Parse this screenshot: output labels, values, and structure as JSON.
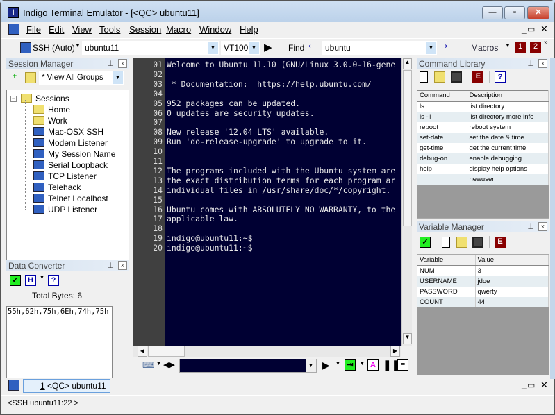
{
  "window": {
    "title": "Indigo Terminal Emulator - [<QC> ubuntu11]",
    "minimize": "—",
    "maximize": "▫",
    "close": "✕"
  },
  "menu": [
    "File",
    "Edit",
    "View",
    "Tools",
    "Session",
    "Macro",
    "Window",
    "Help"
  ],
  "toolbar": {
    "protocol": "SSH (Auto)",
    "host": "ubuntu11",
    "emulation": "VT100",
    "find_label": "Find",
    "find_value": "ubuntu",
    "macros_label": "Macros",
    "macro1": "1",
    "macro2": "2"
  },
  "session_manager": {
    "title": "Session  Manager",
    "group_filter": "* View All Groups",
    "root": "Sessions",
    "items": [
      {
        "label": "Home",
        "icon": "folder"
      },
      {
        "label": "Work",
        "icon": "folder"
      },
      {
        "label": "Mac-OSX SSH",
        "icon": "ssh"
      },
      {
        "label": "Modem Listener",
        "icon": "modem"
      },
      {
        "label": "My Session Name",
        "icon": "ssh"
      },
      {
        "label": "Serial Loopback",
        "icon": "serial"
      },
      {
        "label": "TCP Listener",
        "icon": "ssh"
      },
      {
        "label": "Telehack",
        "icon": "telnet"
      },
      {
        "label": "Telnet Localhost",
        "icon": "telnet"
      },
      {
        "label": "UDP Listener",
        "icon": "ssh"
      }
    ]
  },
  "data_converter": {
    "title": "Data Converter",
    "total_bytes": "Total Bytes: 6",
    "output": "55h,62h,75h,6Eh,74h,75h",
    "mode": "H"
  },
  "terminal": {
    "lines": [
      [
        "01",
        "Welcome to Ubuntu 11.10 (GNU/Linux 3.0.0-16-gene"
      ],
      [
        "02",
        ""
      ],
      [
        "03",
        " * Documentation:  https://help.ubuntu.com/"
      ],
      [
        "04",
        ""
      ],
      [
        "05",
        "952 packages can be updated."
      ],
      [
        "06",
        "0 updates are security updates."
      ],
      [
        "07",
        ""
      ],
      [
        "08",
        "New release '12.04 LTS' available."
      ],
      [
        "09",
        "Run 'do-release-upgrade' to upgrade to it."
      ],
      [
        "10",
        ""
      ],
      [
        "11",
        ""
      ],
      [
        "12",
        "The programs included with the Ubuntu system are"
      ],
      [
        "13",
        "the exact distribution terms for each program ar"
      ],
      [
        "14",
        "individual files in /usr/share/doc/*/copyright."
      ],
      [
        "15",
        ""
      ],
      [
        "16",
        "Ubuntu comes with ABSOLUTELY NO WARRANTY, to the"
      ],
      [
        "17",
        "applicable law."
      ],
      [
        "18",
        ""
      ],
      [
        "19",
        "indigo@ubuntu11:~$"
      ],
      [
        "20",
        "indigo@ubuntu11:~$"
      ]
    ]
  },
  "command_library": {
    "title": "Command Library",
    "headers": [
      "Command",
      "Description"
    ],
    "rows": [
      [
        "ls",
        "list directory"
      ],
      [
        "ls -ll",
        "list directory more info"
      ],
      [
        "reboot",
        "reboot system"
      ],
      [
        "set-date",
        "set the date & time"
      ],
      [
        "get-time",
        "get the current time"
      ],
      [
        "debug-on",
        "enable debugging"
      ],
      [
        "help",
        "display help options"
      ],
      [
        "",
        "newuser"
      ]
    ]
  },
  "variable_manager": {
    "title": "Variable Manager",
    "headers": [
      "Variable",
      "Value"
    ],
    "rows": [
      [
        "NUM",
        "3"
      ],
      [
        "USERNAME",
        "jdoe"
      ],
      [
        "PASSWORD",
        "qwerty"
      ],
      [
        "COUNT",
        "44"
      ]
    ]
  },
  "tabs": [
    {
      "number": "1",
      "label": " <QC> ubuntu11"
    }
  ],
  "status": "<SSH ubuntu11:22 >"
}
